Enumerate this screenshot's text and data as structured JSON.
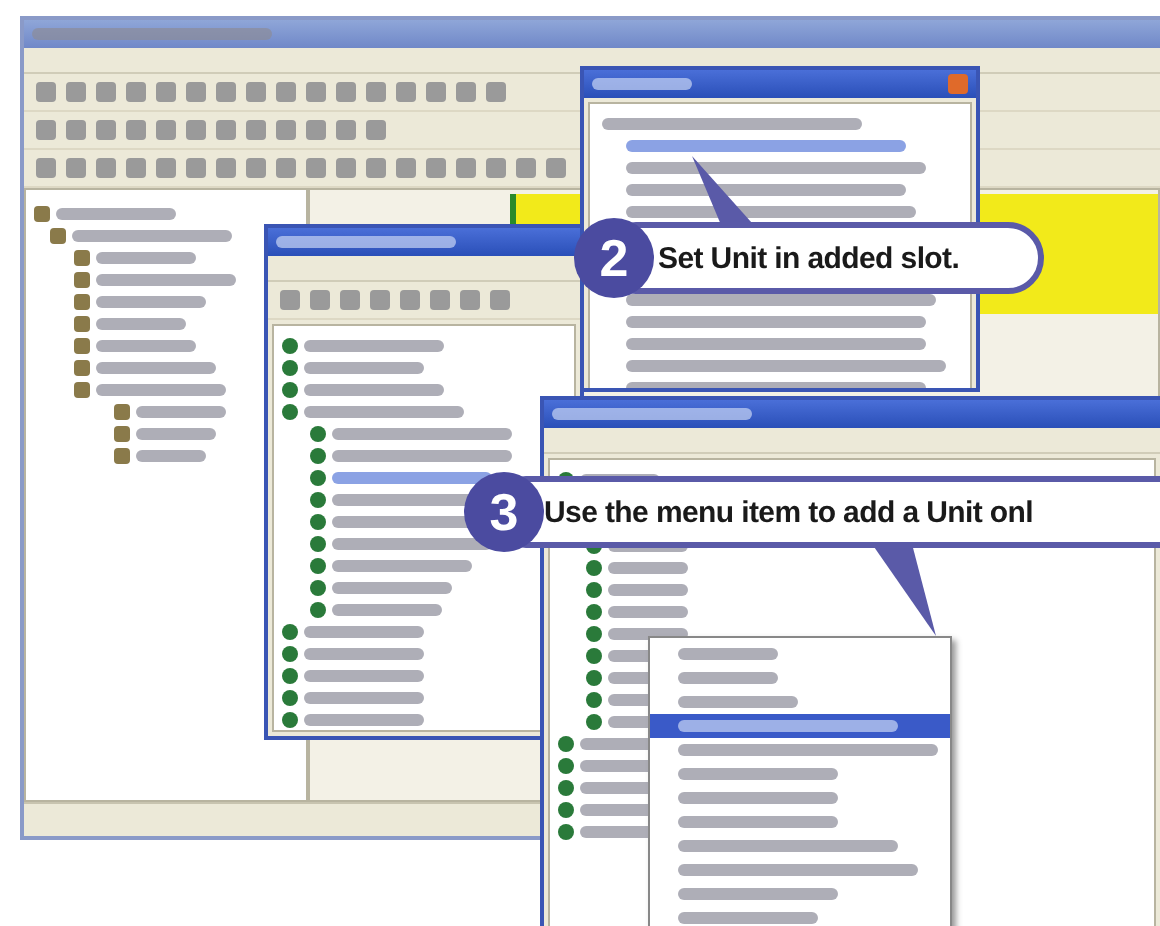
{
  "callouts": [
    {
      "number": "2",
      "text": "Set Unit in added slot."
    },
    {
      "number": "3",
      "text": "Use the menu item to add a Unit onl"
    }
  ]
}
